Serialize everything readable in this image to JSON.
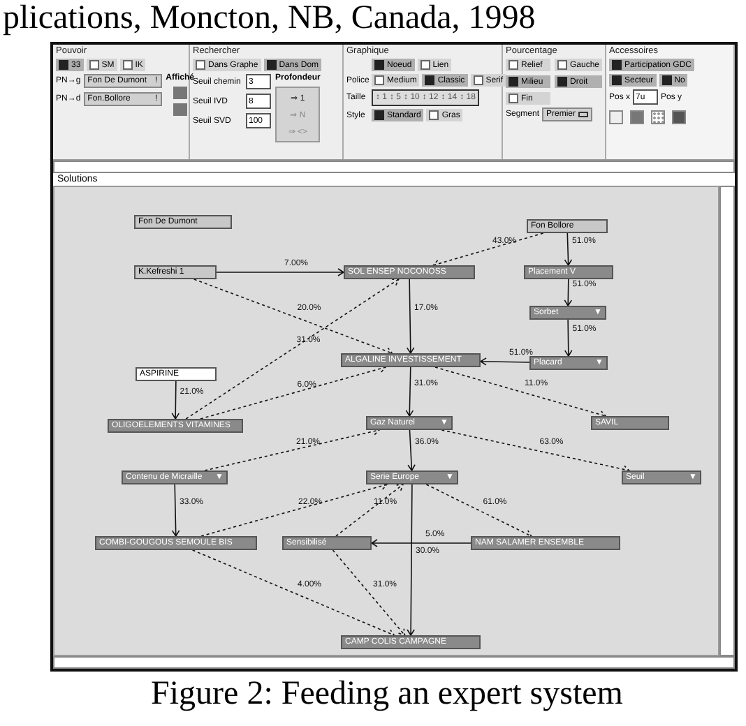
{
  "header_text": "plications, Moncton, NB, Canada, 1998",
  "pouvoir": {
    "title": "Pouvoir",
    "options": [
      {
        "label": "33",
        "checked": true
      },
      {
        "label": "SM",
        "checked": false
      },
      {
        "label": "IK",
        "checked": false
      }
    ],
    "fields": [
      {
        "label": "PN→g",
        "value": "Fon De Dumont",
        "button": "!"
      },
      {
        "label": "PN→d",
        "value": "Fon.Bollore",
        "button": "!"
      }
    ],
    "display_label": "Affiché",
    "display": [
      {
        "checked": true
      },
      {
        "checked": true
      }
    ]
  },
  "rechercher": {
    "title": "Rechercher",
    "options": [
      {
        "label": "Dans Graphe",
        "checked": false
      },
      {
        "label": "Dans Dom",
        "checked": true
      }
    ],
    "fields": [
      {
        "label": "Seuil chemin",
        "value": "3"
      },
      {
        "label": "Seuil IVD",
        "value": "8"
      },
      {
        "label": "Seuil SVD",
        "value": "100"
      }
    ],
    "depth_label": "Profondeur",
    "depth": [
      {
        "label": "⇒ 1",
        "selected": true
      },
      {
        "label": "⇒ N",
        "selected": false
      },
      {
        "label": "⇒ <>",
        "selected": false
      }
    ]
  },
  "graphique": {
    "title": "Graphique",
    "rows": [
      {
        "kind": "checks",
        "options": [
          {
            "label": "Noeud",
            "checked": true
          },
          {
            "label": "Lien",
            "checked": false
          }
        ]
      },
      {
        "kind": "checks",
        "label": "Police",
        "options": [
          {
            "label": "Medium",
            "checked": false
          },
          {
            "label": "Classic",
            "checked": true
          },
          {
            "label": "Serif",
            "checked": false
          }
        ]
      },
      {
        "kind": "sizes",
        "label": "Taille",
        "sizes": [
          "↕ 1",
          "↕ 5",
          "↕ 10",
          "↕ 12",
          "↕ 14",
          "↕ 18"
        ]
      },
      {
        "kind": "checks",
        "label": "Style",
        "options": [
          {
            "label": "Standard",
            "checked": true
          },
          {
            "label": "Gras",
            "checked": false
          }
        ]
      }
    ]
  },
  "pourcentage": {
    "title": "Pourcentage",
    "options": [
      {
        "label": "Relief",
        "checked": false
      },
      {
        "label": "Gauche",
        "checked": false
      },
      {
        "label": "Milieu",
        "checked": true
      },
      {
        "label": "Droit",
        "checked": true
      },
      {
        "label": "Fin",
        "checked": false
      }
    ],
    "segment_label": "Segment",
    "segment_value": "Premier"
  },
  "accessoires": {
    "title": "Accessoires",
    "options": [
      {
        "label": "Participation GDC",
        "checked": true
      },
      {
        "label": "Secteur",
        "checked": true
      },
      {
        "label": "No",
        "checked": true
      }
    ],
    "fields": [
      {
        "label": "Pos x",
        "value": "7u"
      },
      {
        "label": "Pos y"
      }
    ]
  },
  "canvas": {
    "title": "Solutions",
    "nodes": [
      {
        "label": "Fon De Dumont",
        "kind": "light"
      },
      {
        "label": "K.Kefreshi 1",
        "kind": "light"
      },
      {
        "label": "SOL ENSEP NOCONOSS",
        "kind": "dark"
      },
      {
        "label": "Fon Bollore",
        "kind": "light"
      },
      {
        "label": "Placement V",
        "kind": "dark"
      },
      {
        "label": "Sorbet",
        "kind": "dark",
        "dropdown_icon": "▼"
      },
      {
        "label": "Placard",
        "kind": "dark",
        "dropdown_icon": "▼"
      },
      {
        "label": "ALGALINE INVESTISSEMENT",
        "kind": "dark"
      },
      {
        "label": "ASPIRINE",
        "kind": "white"
      },
      {
        "label": "OLIGOELEMENTS VITAMINES",
        "kind": "dark"
      },
      {
        "label": "Gaz Naturel",
        "kind": "dark",
        "dropdown_icon": "▼"
      },
      {
        "label": "SAVIL",
        "kind": "dark"
      },
      {
        "label": "Contenu de Micraille",
        "kind": "dark",
        "dropdown_icon": "▼"
      },
      {
        "label": "Serie Europe",
        "kind": "dark",
        "dropdown_icon": "▼"
      },
      {
        "label": "Seuil",
        "kind": "dark",
        "dropdown_icon": "▼"
      },
      {
        "label": "COMBI-GOUGOUS SEMOULE BIS",
        "kind": "dark"
      },
      {
        "label": "Sensibilisé",
        "kind": "dark"
      },
      {
        "label": "NAM SALAMER ENSEMBLE",
        "kind": "dark"
      },
      {
        "label": "CAMP COLIS CAMPAGNE",
        "kind": "dark"
      }
    ],
    "edges": [
      {
        "label": "43.0%",
        "dotted": true
      },
      {
        "label": "51.0%",
        "dotted": false
      },
      {
        "label": "7.00%",
        "dotted": false
      },
      {
        "label": "51.0%",
        "dotted": false
      },
      {
        "label": "20.0%",
        "dotted": true
      },
      {
        "label": "17.0%",
        "dotted": false
      },
      {
        "label": "51.0%",
        "dotted": false
      },
      {
        "label": "31.0%",
        "dotted": true
      },
      {
        "label": "51.0%",
        "dotted": false
      },
      {
        "label": "21.0%",
        "dotted": false
      },
      {
        "label": "6.0%",
        "dotted": true
      },
      {
        "label": "31.0%",
        "dotted": false
      },
      {
        "label": "11.0%",
        "dotted": true
      },
      {
        "label": "21.0%",
        "dotted": true
      },
      {
        "label": "36.0%",
        "dotted": false
      },
      {
        "label": "63.0%",
        "dotted": true
      },
      {
        "label": "33.0%",
        "dotted": false
      },
      {
        "label": "22.0%",
        "dotted": true
      },
      {
        "label": "11.0%",
        "dotted": true
      },
      {
        "label": "61.0%",
        "dotted": true
      },
      {
        "label": "5.0%",
        "dotted": false
      },
      {
        "label": "30.0%",
        "dotted": false
      },
      {
        "label": "4.00%",
        "dotted": true
      },
      {
        "label": "31.0%",
        "dotted": true
      }
    ]
  },
  "caption": "Figure 2: Feeding an expert system"
}
